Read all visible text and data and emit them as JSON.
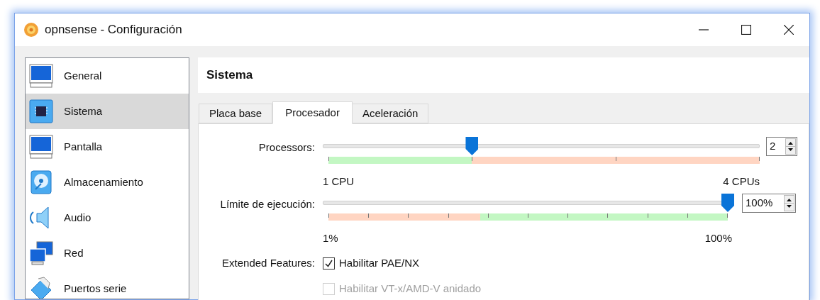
{
  "window": {
    "title": "opnsense - Configuración"
  },
  "sidebar": {
    "items": [
      {
        "label": "General",
        "selected": false
      },
      {
        "label": "Sistema",
        "selected": true
      },
      {
        "label": "Pantalla",
        "selected": false
      },
      {
        "label": "Almacenamiento",
        "selected": false
      },
      {
        "label": "Audio",
        "selected": false
      },
      {
        "label": "Red",
        "selected": false
      },
      {
        "label": "Puertos serie",
        "selected": false
      }
    ]
  },
  "header": "Sistema",
  "tabs": [
    {
      "label": "Placa base",
      "selected": false
    },
    {
      "label": "Procesador",
      "selected": true
    },
    {
      "label": "Aceleración",
      "selected": false
    }
  ],
  "sliders": [
    {
      "label": "Processors:",
      "level": 0.333,
      "value": "2",
      "min_label": "1 CPU",
      "max_label": "4 CPUs"
    },
    {
      "label": "Límite de ejecución:",
      "level": 1.0,
      "value": "100%",
      "min_label": "1%",
      "max_label": "100%"
    }
  ],
  "extended_features": {
    "label": "Extended Features:",
    "options": [
      {
        "label": "Habilitar PAE/NX",
        "checked": true,
        "disabled": false
      },
      {
        "label": "Habilitar VT-x/AMD-V anidado",
        "checked": false,
        "disabled": true
      }
    ]
  }
}
